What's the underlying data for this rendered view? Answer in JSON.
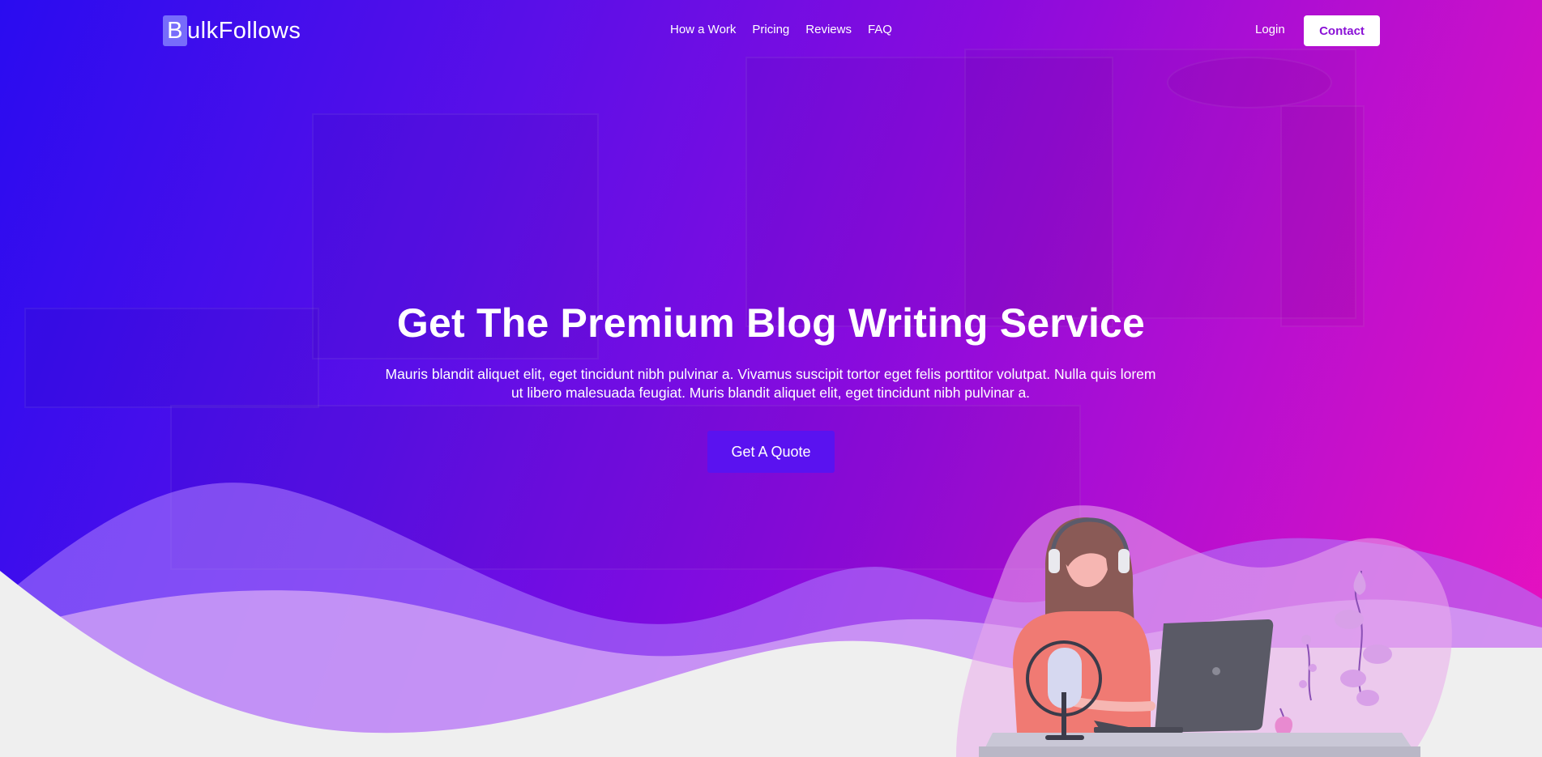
{
  "brand": {
    "logo_initial": "B",
    "logo_rest": "ulkFollows"
  },
  "nav": {
    "items": [
      {
        "label": "How a Work"
      },
      {
        "label": "Pricing"
      },
      {
        "label": "Reviews"
      },
      {
        "label": "FAQ"
      }
    ],
    "login_label": "Login",
    "contact_label": "Contact"
  },
  "hero": {
    "headline": "Get The Premium Blog Writing Service",
    "subtext": "Mauris blandit aliquet elit, eget tincidunt nibh pulvinar a. Vivamus suscipit tortor eget felis porttitor volutpat. Nulla quis lorem ut libero malesuada feugiat. Muris blandit aliquet elit, eget tincidunt nibh pulvinar a.",
    "cta_label": "Get A Quote"
  },
  "colors": {
    "gradient_start": "#2a0cf0",
    "gradient_end": "#ea11be",
    "cta_background": "#5a12f0",
    "contact_text": "#8a11d6",
    "page_background": "#efefef"
  },
  "illustration": {
    "subject": "woman-podcaster-with-headphones-microphone-and-laptop"
  }
}
